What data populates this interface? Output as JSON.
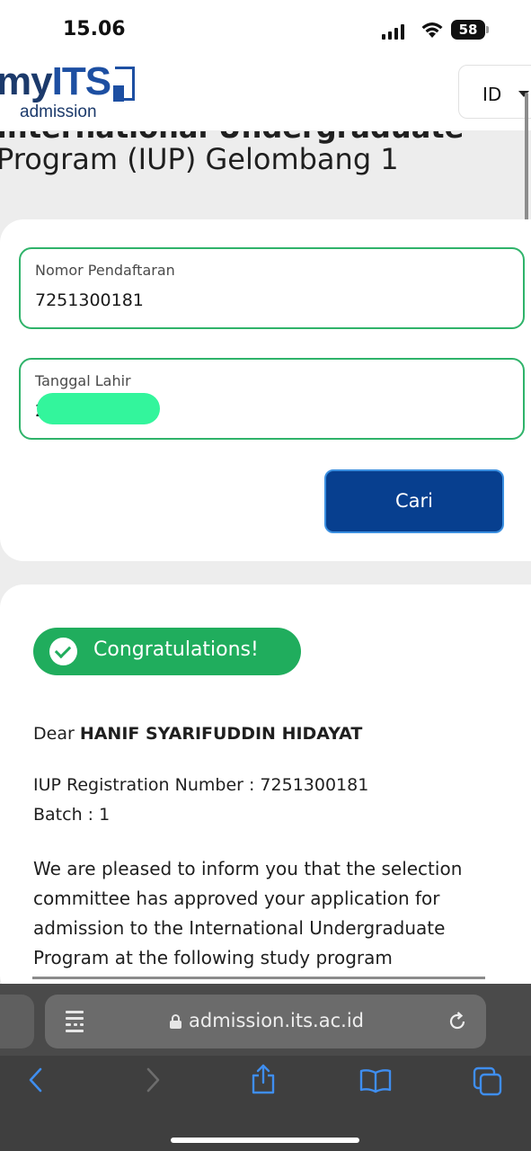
{
  "status_bar": {
    "time": "15.06",
    "battery": "58"
  },
  "header": {
    "logo_prefix": "my",
    "logo_brand": "ITS",
    "logo_sub": "admission",
    "language": "ID"
  },
  "page": {
    "title_partial": "International Undergraduate",
    "title": "Program (IUP) Gelombang 1"
  },
  "form": {
    "registration_label": "Nomor Pendaftaran",
    "registration_value": "7251300181",
    "birthdate_label": "Tanggal Lahir",
    "birthdate_value": "2",
    "search_button": "Cari"
  },
  "result": {
    "badge": "Congratulations!",
    "greeting": "Dear",
    "name": "HANIF SYARIFUDDIN HIDAYAT",
    "registration_line": "IUP Registration Number : 7251300181",
    "batch_line": "Batch : 1",
    "message": "We are pleased to inform you that the selection committee has approved your application for admission to the International Undergraduate Program at the following study program"
  },
  "browser": {
    "url": "admission.its.ac.id"
  },
  "colors": {
    "accent_green": "#20ad5d",
    "button_blue": "#073f8f",
    "field_border": "#2fb36a"
  },
  "icons": [
    "signal-icon",
    "wifi-icon",
    "battery-icon",
    "chevron-down-icon",
    "check-icon",
    "reader-icon",
    "lock-icon",
    "reload-icon",
    "back-icon",
    "forward-icon",
    "share-icon",
    "bookmarks-icon",
    "tabs-icon"
  ]
}
